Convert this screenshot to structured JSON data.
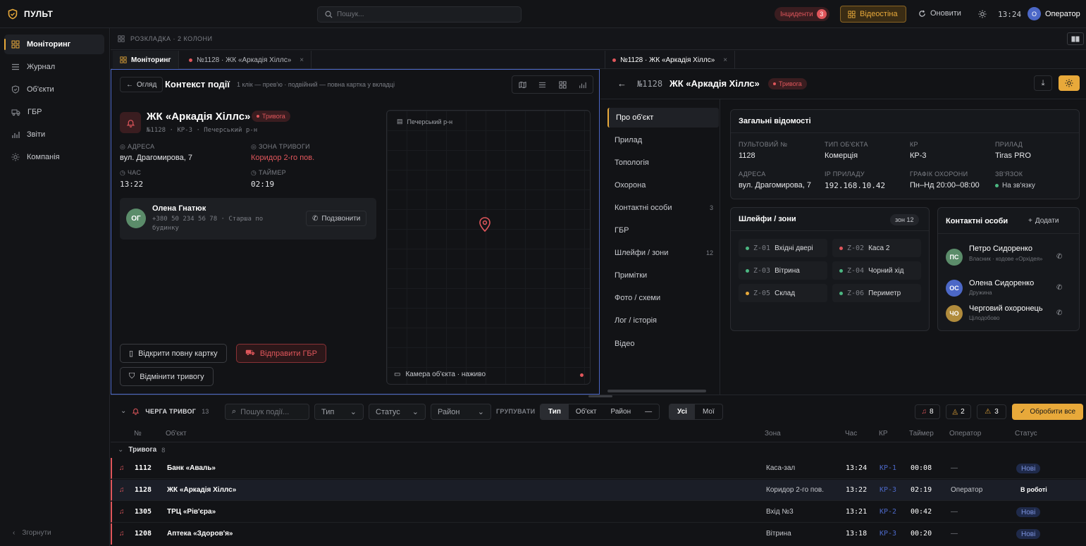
{
  "app": {
    "brand": "ПУЛЬТ",
    "search_placeholder": "Пошук...",
    "incidents_label": "Інциденти",
    "incidents_count": "3",
    "videowall_label": "Відеостіна",
    "refresh_label": "Оновити",
    "clock": "13:24",
    "user_initial": "О",
    "user_name": "Оператор"
  },
  "sidebar": {
    "items": [
      {
        "label": "Моніторинг",
        "icon": "grid-icon"
      },
      {
        "label": "Журнал",
        "icon": "list-icon"
      },
      {
        "label": "Об'єкти",
        "icon": "shield-icon"
      },
      {
        "label": "ГБР",
        "icon": "car-icon"
      },
      {
        "label": "Звіти",
        "icon": "chart-icon"
      },
      {
        "label": "Компанія",
        "icon": "sun-icon"
      }
    ],
    "collapse_label": "Згорнути"
  },
  "layout": {
    "label": "РОЗКЛАДКА · 2 КОЛОНИ"
  },
  "left_tabs": [
    {
      "label": "Моніторинг"
    },
    {
      "label": "№1128 · ЖК «Аркадія Хіллс»"
    }
  ],
  "right_tabs": [
    {
      "label": "№1128 · ЖК «Аркадія Хіллс»"
    }
  ],
  "context": {
    "back_label": "Огляд",
    "title": "Контекст події",
    "hint": "1 клік — прев'ю · подвійний — повна картка у вкладці",
    "object_name": "ЖК «Аркадія Хіллс»",
    "status_badge": "Тривога",
    "meta": "№1128 · КР-3 · Печерський р-н",
    "address_label": "АДРЕСА",
    "address": "вул. Драгомирова, 7",
    "zone_label": "ЗОНА ТРИВОГИ",
    "zone": "Коридор 2-го пов.",
    "time_label": "ЧАС",
    "time": "13:22",
    "timer_label": "ТАЙМЕР",
    "timer": "02:19",
    "contact_initials": "ОГ",
    "contact_name": "Олена Гнатюк",
    "contact_phone": "+380 50 234 56 78 · Старша по будинку",
    "call_label": "Подзвонити",
    "map_district": "Печерський р-н",
    "camera_label": "Камера об'єкта · наживо",
    "open_card_label": "Відкрити повну картку",
    "send_gbr_label": "Відправити ГБР",
    "cancel_alarm_label": "Відмінити тривогу"
  },
  "detail": {
    "number": "№1128",
    "title": "ЖК «Аркадія Хіллс»",
    "status_badge": "Тривога",
    "tabs": [
      {
        "label": "Про об'єкт",
        "count": ""
      },
      {
        "label": "Прилад",
        "count": ""
      },
      {
        "label": "Топологія",
        "count": ""
      },
      {
        "label": "Охорона",
        "count": ""
      },
      {
        "label": "Контактні особи",
        "count": "3"
      },
      {
        "label": "ГБР",
        "count": ""
      },
      {
        "label": "Шлейфи / зони",
        "count": "12"
      },
      {
        "label": "Примітки",
        "count": ""
      },
      {
        "label": "Фото / схеми",
        "count": ""
      },
      {
        "label": "Лог / історія",
        "count": ""
      },
      {
        "label": "Відео",
        "count": ""
      }
    ],
    "general_title": "Загальні відомості",
    "fields": [
      {
        "label": "ПУЛЬТОВИЙ №",
        "value": "1128"
      },
      {
        "label": "ТИП ОБ'ЄКТА",
        "value": "Комерція"
      },
      {
        "label": "КР",
        "value": "КР-3"
      },
      {
        "label": "ПРИЛАД",
        "value": "Tiras PRO"
      },
      {
        "label": "АДРЕСА",
        "value": "вул. Драгомирова, 7"
      },
      {
        "label": "IP ПРИЛАДУ",
        "value": "192.168.10.42"
      },
      {
        "label": "ГРАФІК ОХОРОНИ",
        "value": "Пн–Нд 20:00–08:00"
      },
      {
        "label": "ЗВ'ЯЗОК",
        "value": "На зв'язку"
      }
    ],
    "zones_title": "Шлейфи / зони",
    "zones_badge": "зон 12",
    "zones": [
      {
        "code": "Z-01",
        "name": "Вхідні двері",
        "color": "#4cb782"
      },
      {
        "code": "Z-02",
        "name": "Каса 2",
        "color": "#e0565b"
      },
      {
        "code": "Z-03",
        "name": "Вітрина",
        "color": "#4cb782"
      },
      {
        "code": "Z-04",
        "name": "Чорний хід",
        "color": "#4cb782"
      },
      {
        "code": "Z-05",
        "name": "Склад",
        "color": "#e8a93a"
      },
      {
        "code": "Z-06",
        "name": "Периметр",
        "color": "#4cb782"
      }
    ],
    "contacts_title": "Контактні особи",
    "add_label": "Додати",
    "contacts": [
      {
        "initials": "ПС",
        "name": "Петро Сидоренко",
        "role": "Власник · кодове «Орхідея»",
        "color": "#5b8c6a"
      },
      {
        "initials": "ОС",
        "name": "Олена Сидоренко",
        "role": "Дружина",
        "color": "#4c68c7"
      },
      {
        "initials": "ЧО",
        "name": "Черговий охоронець",
        "role": "Цілодобово",
        "color": "#b08b3c"
      }
    ]
  },
  "queue": {
    "title": "ЧЕРГА ТРИВОГ",
    "count": "13",
    "search_placeholder": "Пошук події...",
    "filters": [
      "Тип",
      "Статус",
      "Район"
    ],
    "group_label": "ГРУПУВАТИ",
    "group_options": [
      "Тип",
      "Об'єкт",
      "Район",
      "—"
    ],
    "scope_options": [
      "Усі",
      "Мої"
    ],
    "counters": [
      "8",
      "2",
      "3"
    ],
    "process_all_label": "Обробити все",
    "columns": [
      "№",
      "Об'єкт",
      "Зона",
      "Час",
      "КР",
      "Таймер",
      "Оператор",
      "Статус"
    ],
    "group_name": "Тривога",
    "group_count": "8",
    "rows": [
      {
        "num": "1112",
        "object": "Банк «Аваль»",
        "zone": "Каса-зал",
        "time": "13:24",
        "kr": "КР-1",
        "timer": "00:08",
        "operator": "—",
        "status": "Нові"
      },
      {
        "num": "1128",
        "object": "ЖК «Аркадія Хіллс»",
        "zone": "Коридор 2-го пов.",
        "time": "13:22",
        "kr": "КР-3",
        "timer": "02:19",
        "operator": "Оператор",
        "status": "В роботі"
      },
      {
        "num": "1305",
        "object": "ТРЦ «Рів'єра»",
        "zone": "Вхід №3",
        "time": "13:21",
        "kr": "КР-2",
        "timer": "00:42",
        "operator": "—",
        "status": "Нові"
      },
      {
        "num": "1208",
        "object": "Аптека «Здоров'я»",
        "zone": "Вітрина",
        "time": "13:18",
        "kr": "КР-3",
        "timer": "00:20",
        "operator": "—",
        "status": "Нові"
      }
    ]
  },
  "colors": {
    "accent": "#e8a93a",
    "alarm": "#e0565b",
    "ok": "#4cb782",
    "bg": "#111215"
  }
}
